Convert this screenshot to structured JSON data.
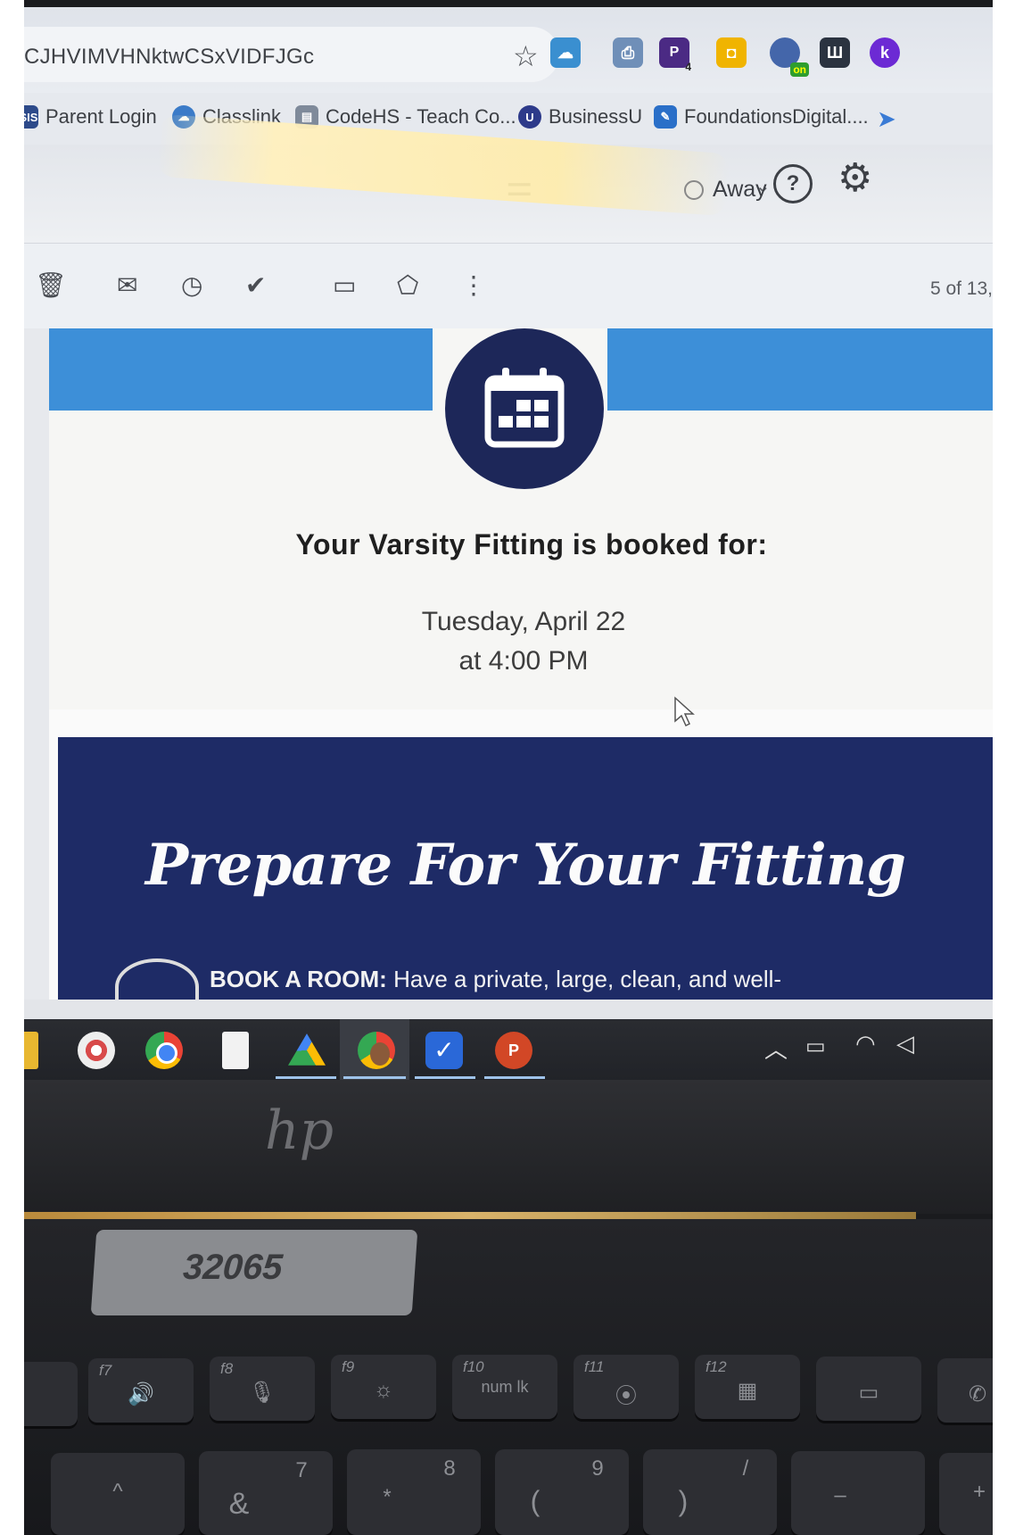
{
  "browser": {
    "url_fragment": "CJHVIMVHNktwCSxVIDFJGc",
    "bookmarks": [
      "Parent Login",
      "Classlink",
      "CodeHS - Teach Co...",
      "BusinessU",
      "FoundationsDigital...."
    ],
    "bookmark_prefix": "SIS",
    "ext_badges": {
      "task_count": "4",
      "on_badge": "on"
    }
  },
  "gmail": {
    "status": "Away",
    "counter": "5 of 13,"
  },
  "email": {
    "headline": "Your Varsity Fitting is booked for:",
    "date_line": "Tuesday, April 22",
    "time_line": "at 4:00 PM",
    "banner_title": "Prepare For Your Fitting",
    "book_label": "BOOK A ROOM:",
    "book_text": "Have a private, large, clean, and well-"
  },
  "laptop": {
    "brand": "hp",
    "sticker": "32065",
    "fkeys": [
      "f7",
      "f8",
      "f9",
      "f10",
      "f11",
      "f12"
    ],
    "numlock_label": "num lk",
    "number_row": [
      {
        "sym": "^",
        "num": ""
      },
      {
        "sym": "&",
        "num": "7"
      },
      {
        "sym": "*",
        "num": "8"
      },
      {
        "sym": "(",
        "num": "9"
      },
      {
        "sym": ")",
        "num": "/"
      },
      {
        "sym": "–",
        "num": ""
      },
      {
        "sym": "+",
        "num": ""
      }
    ]
  },
  "colors": {
    "email_blue": "#3d8fd8",
    "email_navy": "#1e2b66",
    "calendar_circle": "#1d2759"
  }
}
